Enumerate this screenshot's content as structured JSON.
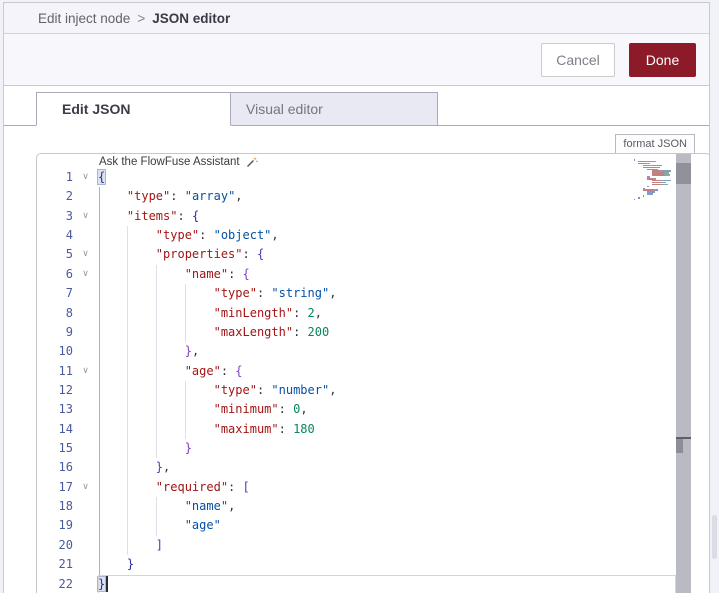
{
  "breadcrumb": {
    "parent": "Edit inject node",
    "separator": ">",
    "current": "JSON editor"
  },
  "buttons": {
    "cancel": "Cancel",
    "done": "Done"
  },
  "tabs": {
    "edit_json": "Edit JSON",
    "visual_editor": "Visual editor"
  },
  "format_button": "format JSON",
  "assistant_hint": {
    "label": "Ask the FlowFuse Assistant"
  },
  "colors": {
    "done_button": "#8c1a28",
    "key": "#a31515",
    "string_value": "#0451a5",
    "number": "#098658",
    "line_number": "#4a5a9f",
    "minimap": {
      "k": "#c47f7f",
      "s": "#7f9cc9",
      "n": "#79b79c",
      "b1": "#8a8ad0",
      "b2": "#8a8ad0",
      "b3": "#8a8ad0",
      "b4": "#9a8ad0",
      "p": "#9a9aa5"
    }
  },
  "editor": {
    "language": "json",
    "fold_glyph": "∨",
    "cursor_line": 22,
    "lines": [
      {
        "n": 1,
        "fold": true,
        "spans": [
          [
            "b1",
            "{",
            "m"
          ]
        ]
      },
      {
        "n": 2,
        "fold": false,
        "spans": [
          [
            "w",
            "    "
          ],
          [
            "k",
            "\"type\""
          ],
          [
            "p",
            ": "
          ],
          [
            "s",
            "\"array\""
          ],
          [
            "p",
            ","
          ]
        ]
      },
      {
        "n": 3,
        "fold": true,
        "spans": [
          [
            "w",
            "    "
          ],
          [
            "k",
            "\"items\""
          ],
          [
            "p",
            ": "
          ],
          [
            "b2",
            "{"
          ]
        ]
      },
      {
        "n": 4,
        "fold": false,
        "spans": [
          [
            "w",
            "        "
          ],
          [
            "k",
            "\"type\""
          ],
          [
            "p",
            ": "
          ],
          [
            "s",
            "\"object\""
          ],
          [
            "p",
            ","
          ]
        ]
      },
      {
        "n": 5,
        "fold": true,
        "spans": [
          [
            "w",
            "        "
          ],
          [
            "k",
            "\"properties\""
          ],
          [
            "p",
            ": "
          ],
          [
            "b3",
            "{"
          ]
        ]
      },
      {
        "n": 6,
        "fold": true,
        "spans": [
          [
            "w",
            "            "
          ],
          [
            "k",
            "\"name\""
          ],
          [
            "p",
            ": "
          ],
          [
            "b4",
            "{"
          ]
        ]
      },
      {
        "n": 7,
        "fold": false,
        "spans": [
          [
            "w",
            "                "
          ],
          [
            "k",
            "\"type\""
          ],
          [
            "p",
            ": "
          ],
          [
            "s",
            "\"string\""
          ],
          [
            "p",
            ","
          ]
        ]
      },
      {
        "n": 8,
        "fold": false,
        "spans": [
          [
            "w",
            "                "
          ],
          [
            "k",
            "\"minLength\""
          ],
          [
            "p",
            ": "
          ],
          [
            "n",
            "2"
          ],
          [
            "p",
            ","
          ]
        ]
      },
      {
        "n": 9,
        "fold": false,
        "spans": [
          [
            "w",
            "                "
          ],
          [
            "k",
            "\"maxLength\""
          ],
          [
            "p",
            ": "
          ],
          [
            "n",
            "200"
          ]
        ]
      },
      {
        "n": 10,
        "fold": false,
        "spans": [
          [
            "w",
            "            "
          ],
          [
            "b4",
            "}"
          ],
          [
            "p",
            ","
          ]
        ]
      },
      {
        "n": 11,
        "fold": true,
        "spans": [
          [
            "w",
            "            "
          ],
          [
            "k",
            "\"age\""
          ],
          [
            "p",
            ": "
          ],
          [
            "b4",
            "{"
          ]
        ]
      },
      {
        "n": 12,
        "fold": false,
        "spans": [
          [
            "w",
            "                "
          ],
          [
            "k",
            "\"type\""
          ],
          [
            "p",
            ": "
          ],
          [
            "s",
            "\"number\""
          ],
          [
            "p",
            ","
          ]
        ]
      },
      {
        "n": 13,
        "fold": false,
        "spans": [
          [
            "w",
            "                "
          ],
          [
            "k",
            "\"minimum\""
          ],
          [
            "p",
            ": "
          ],
          [
            "n",
            "0"
          ],
          [
            "p",
            ","
          ]
        ]
      },
      {
        "n": 14,
        "fold": false,
        "spans": [
          [
            "w",
            "                "
          ],
          [
            "k",
            "\"maximum\""
          ],
          [
            "p",
            ": "
          ],
          [
            "n",
            "180"
          ]
        ]
      },
      {
        "n": 15,
        "fold": false,
        "spans": [
          [
            "w",
            "            "
          ],
          [
            "b4",
            "}"
          ]
        ]
      },
      {
        "n": 16,
        "fold": false,
        "spans": [
          [
            "w",
            "        "
          ],
          [
            "b3",
            "}"
          ],
          [
            "p",
            ","
          ]
        ]
      },
      {
        "n": 17,
        "fold": true,
        "spans": [
          [
            "w",
            "        "
          ],
          [
            "k",
            "\"required\""
          ],
          [
            "p",
            ": "
          ],
          [
            "b3",
            "["
          ]
        ]
      },
      {
        "n": 18,
        "fold": false,
        "spans": [
          [
            "w",
            "            "
          ],
          [
            "s",
            "\"name\""
          ],
          [
            "p",
            ","
          ]
        ]
      },
      {
        "n": 19,
        "fold": false,
        "spans": [
          [
            "w",
            "            "
          ],
          [
            "s",
            "\"age\""
          ]
        ]
      },
      {
        "n": 20,
        "fold": false,
        "spans": [
          [
            "w",
            "        "
          ],
          [
            "b3",
            "]"
          ]
        ]
      },
      {
        "n": 21,
        "fold": false,
        "spans": [
          [
            "w",
            "    "
          ],
          [
            "b2",
            "}"
          ]
        ]
      },
      {
        "n": 22,
        "fold": false,
        "spans": [
          [
            "b1",
            "}",
            "m"
          ]
        ]
      }
    ]
  }
}
